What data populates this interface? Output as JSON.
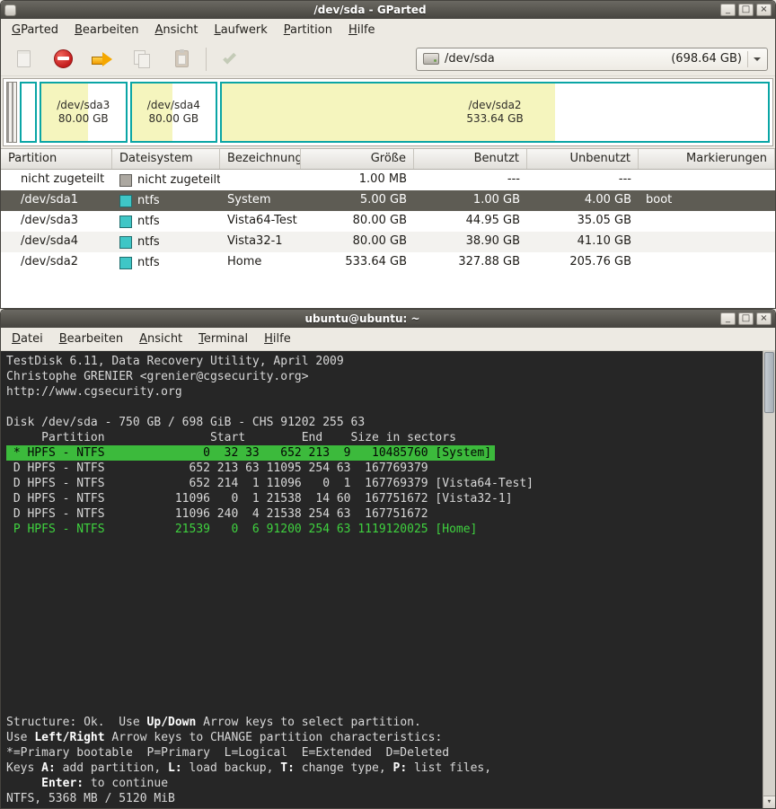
{
  "gparted": {
    "title": "/dev/sda - GParted",
    "buttons": {
      "minimize": "_",
      "maximize": "□",
      "close": "×"
    },
    "menu": [
      "GParted",
      "Bearbeiten",
      "Ansicht",
      "Laufwerk",
      "Partition",
      "Hilfe"
    ],
    "toolbar_icons": [
      "new-partition-icon",
      "delete-partition-icon",
      "resize-move-icon",
      "copy-icon",
      "paste-icon",
      "apply-icon"
    ],
    "device_combo": {
      "device": "/dev/sda",
      "capacity": "(698.64 GB)"
    },
    "visual_bar": {
      "partitions": [
        {
          "name": "/dev/sda3",
          "size": "80.00 GB",
          "width_pct": 12,
          "used_pct": 56
        },
        {
          "name": "/dev/sda4",
          "size": "80.00 GB",
          "width_pct": 12,
          "used_pct": 49
        },
        {
          "name": "/dev/sda2",
          "size": "533.64 GB",
          "width_pct": null,
          "used_pct": 61
        }
      ]
    },
    "table": {
      "headers": [
        "Partition",
        "Dateisystem",
        "Bezeichnung",
        "Größe",
        "Benutzt",
        "Unbenutzt",
        "Markierungen"
      ],
      "rows": [
        {
          "partition": "nicht zugeteilt",
          "fs": "nicht zugeteilt",
          "fs_class": "unallocated",
          "label": "",
          "size": "1.00 MB",
          "used": "---",
          "unused": "---",
          "flags": "",
          "state": ""
        },
        {
          "partition": "/dev/sda1",
          "fs": "ntfs",
          "fs_class": "ntfs",
          "label": "System",
          "size": "5.00 GB",
          "used": "1.00 GB",
          "unused": "4.00 GB",
          "flags": "boot",
          "state": "selected"
        },
        {
          "partition": "/dev/sda3",
          "fs": "ntfs",
          "fs_class": "ntfs",
          "label": "Vista64-Test",
          "size": "80.00 GB",
          "used": "44.95 GB",
          "unused": "35.05 GB",
          "flags": "",
          "state": ""
        },
        {
          "partition": "/dev/sda4",
          "fs": "ntfs",
          "fs_class": "ntfs",
          "label": "Vista32-1",
          "size": "80.00 GB",
          "used": "38.90 GB",
          "unused": "41.10 GB",
          "flags": "",
          "state": "stripe"
        },
        {
          "partition": "/dev/sda2",
          "fs": "ntfs",
          "fs_class": "ntfs",
          "label": "Home",
          "size": "533.64 GB",
          "used": "327.88 GB",
          "unused": "205.76 GB",
          "flags": "",
          "state": ""
        }
      ]
    },
    "colors": {
      "ntfs_swatch": "#3FC6C6",
      "unallocated_swatch": "#ACA8A1",
      "used_fill": "#F5F5BE",
      "partition_border": "#0AA5A5",
      "selected_row": "#5E5C54"
    }
  },
  "terminal": {
    "title": "ubuntu@ubuntu: ~",
    "buttons": {
      "minimize": "_",
      "maximize": "□",
      "close": "×"
    },
    "menu": [
      "Datei",
      "Bearbeiten",
      "Ansicht",
      "Terminal",
      "Hilfe"
    ],
    "scroll_down_glyph": "▾",
    "colors": {
      "background": "#262626",
      "text": "#D8D8D8",
      "selected_bg": "#3CBA3C",
      "green_text": "#3FD23F"
    },
    "top_lines": [
      {
        "cls": "",
        "segs": [
          {
            "t": "TestDisk 6.11, Data Recovery Utility, April 2009"
          }
        ]
      },
      {
        "cls": "",
        "segs": [
          {
            "t": "Christophe GRENIER <grenier@cgsecurity.org>"
          }
        ]
      },
      {
        "cls": "",
        "segs": [
          {
            "t": "http://www.cgsecurity.org"
          }
        ]
      },
      {
        "cls": "",
        "segs": []
      },
      {
        "cls": "",
        "segs": [
          {
            "t": "Disk /dev/sda - 750 GB / 698 GiB - CHS 91202 255 63"
          }
        ]
      },
      {
        "cls": "",
        "segs": [
          {
            "t": "     Partition               Start        End    Size in sectors"
          }
        ]
      },
      {
        "cls": "selected",
        "segs": [
          {
            "t": " * HPFS - NTFS              0  32 33   652 213  9   10485760 [System]"
          }
        ]
      },
      {
        "cls": "",
        "segs": [
          {
            "t": " D HPFS - NTFS            652 213 63 11095 254 63  167769379"
          }
        ]
      },
      {
        "cls": "",
        "segs": [
          {
            "t": " D HPFS - NTFS            652 214  1 11096   0  1  167769379 [Vista64-Test]"
          }
        ]
      },
      {
        "cls": "",
        "segs": [
          {
            "t": " D HPFS - NTFS          11096   0  1 21538  14 60  167751672 [Vista32-1]"
          }
        ]
      },
      {
        "cls": "",
        "segs": [
          {
            "t": " D HPFS - NTFS          11096 240  4 21538 254 63  167751672"
          }
        ]
      },
      {
        "cls": "green",
        "segs": [
          {
            "t": " P HPFS - NTFS          21539   0  6 91200 254 63 1119120025 [Home]"
          }
        ]
      }
    ],
    "bottom_lines": [
      {
        "cls": "",
        "segs": [
          {
            "t": "Structure: Ok.  Use "
          },
          {
            "t": "Up/Down",
            "b": true
          },
          {
            "t": " Arrow keys to select partition."
          }
        ]
      },
      {
        "cls": "",
        "segs": [
          {
            "t": "Use "
          },
          {
            "t": "Left/Right",
            "b": true
          },
          {
            "t": " Arrow keys to CHANGE partition characteristics:"
          }
        ]
      },
      {
        "cls": "",
        "segs": [
          {
            "t": "*=Primary bootable  P=Primary  L=Logical  E=Extended  D=Deleted"
          }
        ]
      },
      {
        "cls": "",
        "segs": [
          {
            "t": "Keys "
          },
          {
            "t": "A:",
            "b": true
          },
          {
            "t": " add partition, "
          },
          {
            "t": "L:",
            "b": true
          },
          {
            "t": " load backup, "
          },
          {
            "t": "T:",
            "b": true
          },
          {
            "t": " change type, "
          },
          {
            "t": "P:",
            "b": true
          },
          {
            "t": " list files,"
          }
        ]
      },
      {
        "cls": "",
        "segs": [
          {
            "t": "     "
          },
          {
            "t": "Enter:",
            "b": true
          },
          {
            "t": " to continue"
          }
        ]
      },
      {
        "cls": "",
        "segs": [
          {
            "t": "NTFS, 5368 MB / 5120 MiB"
          }
        ]
      }
    ]
  }
}
